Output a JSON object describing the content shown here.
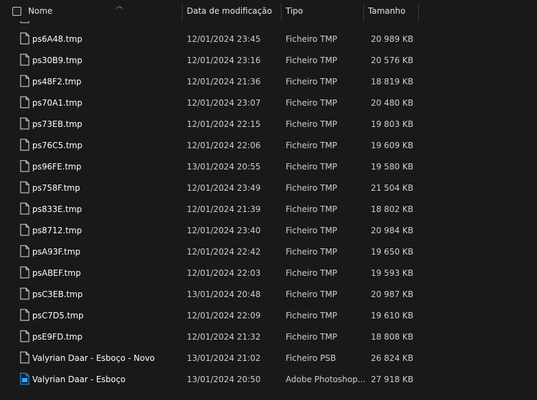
{
  "header": {
    "name_label": "Nome",
    "date_label": "Data de modificação",
    "type_label": "Tipo",
    "size_label": "Tamanho"
  },
  "files": [
    {
      "name": "ps6A48.tmp",
      "date": "12/01/2024 23:45",
      "type": "Ficheiro TMP",
      "size": "20 989 KB",
      "icon": "file-icon"
    },
    {
      "name": "ps30B9.tmp",
      "date": "12/01/2024 23:16",
      "type": "Ficheiro TMP",
      "size": "20 576 KB",
      "icon": "file-icon"
    },
    {
      "name": "ps48F2.tmp",
      "date": "12/01/2024 21:36",
      "type": "Ficheiro TMP",
      "size": "18 819 KB",
      "icon": "file-icon"
    },
    {
      "name": "ps70A1.tmp",
      "date": "12/01/2024 23:07",
      "type": "Ficheiro TMP",
      "size": "20 480 KB",
      "icon": "file-icon"
    },
    {
      "name": "ps73EB.tmp",
      "date": "12/01/2024 22:15",
      "type": "Ficheiro TMP",
      "size": "19 803 KB",
      "icon": "file-icon"
    },
    {
      "name": "ps76C5.tmp",
      "date": "12/01/2024 22:06",
      "type": "Ficheiro TMP",
      "size": "19 609 KB",
      "icon": "file-icon"
    },
    {
      "name": "ps96FE.tmp",
      "date": "13/01/2024 20:55",
      "type": "Ficheiro TMP",
      "size": "19 580 KB",
      "icon": "file-icon"
    },
    {
      "name": "ps758F.tmp",
      "date": "12/01/2024 23:49",
      "type": "Ficheiro TMP",
      "size": "21 504 KB",
      "icon": "file-icon"
    },
    {
      "name": "ps833E.tmp",
      "date": "12/01/2024 21:39",
      "type": "Ficheiro TMP",
      "size": "18 802 KB",
      "icon": "file-icon"
    },
    {
      "name": "ps8712.tmp",
      "date": "12/01/2024 23:40",
      "type": "Ficheiro TMP",
      "size": "20 984 KB",
      "icon": "file-icon"
    },
    {
      "name": "psA93F.tmp",
      "date": "12/01/2024 22:42",
      "type": "Ficheiro TMP",
      "size": "19 650 KB",
      "icon": "file-icon"
    },
    {
      "name": "psABEF.tmp",
      "date": "12/01/2024 22:03",
      "type": "Ficheiro TMP",
      "size": "19 593 KB",
      "icon": "file-icon"
    },
    {
      "name": "psC3EB.tmp",
      "date": "13/01/2024 20:48",
      "type": "Ficheiro TMP",
      "size": "20 987 KB",
      "icon": "file-icon"
    },
    {
      "name": "psC7D5.tmp",
      "date": "12/01/2024 22:09",
      "type": "Ficheiro TMP",
      "size": "19 610 KB",
      "icon": "file-icon"
    },
    {
      "name": "psE9FD.tmp",
      "date": "12/01/2024 21:32",
      "type": "Ficheiro TMP",
      "size": "18 808 KB",
      "icon": "file-icon"
    },
    {
      "name": "Valyrian Daar - Esboço - Novo",
      "date": "13/01/2024 21:02",
      "type": "Ficheiro PSB",
      "size": "26 824 KB",
      "icon": "file-icon"
    },
    {
      "name": "Valyrian Daar - Esboço",
      "date": "13/01/2024 20:50",
      "type": "Adobe Photoshop...",
      "size": "27 918 KB",
      "icon": "photoshop-file-icon"
    }
  ],
  "colors": {
    "background": "#191919",
    "text": "#ffffff",
    "secondary_text": "#cfcfcf",
    "separator": "#3a3a3a",
    "photoshop_icon": "#31a8ff"
  }
}
